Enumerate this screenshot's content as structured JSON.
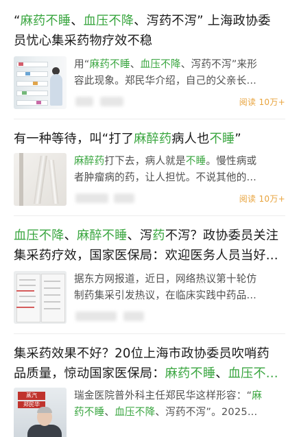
{
  "articles": [
    {
      "title_lines": [
        [
          {
            "text": "“",
            "hl": false
          },
          {
            "text": "麻药不睡",
            "hl": true
          },
          {
            "text": "、",
            "hl": false
          },
          {
            "text": "血压不降",
            "hl": true
          },
          {
            "text": "、泻药不泻” 上海政协委",
            "hl": false
          }
        ],
        [
          {
            "text": "员忧心集采药物疗效不稳",
            "hl": false
          }
        ]
      ],
      "snippet_lines": [
        [
          {
            "text": "用“",
            "hl": false
          },
          {
            "text": "麻药不睡",
            "hl": true
          },
          {
            "text": "、",
            "hl": false
          },
          {
            "text": "血压不降",
            "hl": true
          },
          {
            "text": "、泻药不泻”来形",
            "hl": false
          }
        ],
        [
          {
            "text": "容此现象。郑民华介绍，自己的父亲长...",
            "hl": false
          }
        ]
      ],
      "reads": "阅读 10万+",
      "thumb_icon": "pharmacy-shelf-thumbnail"
    },
    {
      "title_lines": [
        [
          {
            "text": "有一种等待，叫“打了",
            "hl": false
          },
          {
            "text": "麻醉药",
            "hl": true
          },
          {
            "text": "病人也",
            "hl": false
          },
          {
            "text": "不睡",
            "hl": true
          },
          {
            "text": "”",
            "hl": false
          }
        ]
      ],
      "snippet_lines": [
        [
          {
            "text": "麻醉药",
            "hl": true
          },
          {
            "text": "打下去，病人就是",
            "hl": false
          },
          {
            "text": "不睡",
            "hl": true
          },
          {
            "text": "。慢性病或",
            "hl": false
          }
        ],
        [
          {
            "text": "者肿瘤病的药，让人担忧。不说其他的...",
            "hl": false
          }
        ]
      ],
      "reads": "阅读 10万+",
      "thumb_icon": "curtain-thumbnail"
    },
    {
      "title_lines": [
        [
          {
            "text": "血压不降",
            "hl": true
          },
          {
            "text": "、",
            "hl": false
          },
          {
            "text": "麻醉不睡",
            "hl": true
          },
          {
            "text": "、泻",
            "hl": false
          },
          {
            "text": "药",
            "hl": true
          },
          {
            "text": "不泻？政协委员关注",
            "hl": false
          }
        ],
        [
          {
            "text": "集采药疗效，国家医保局：欢迎医务人员当好...",
            "hl": false
          }
        ]
      ],
      "snippet_lines": [
        [
          {
            "text": "据东方网报道，近日，网络热议第十轮仿",
            "hl": false
          }
        ],
        [
          {
            "text": "制药集采引发热议，在临床实践中药品...",
            "hl": false
          }
        ]
      ],
      "reads": "",
      "thumb_icon": "document-thumbnail"
    },
    {
      "title_lines": [
        [
          {
            "text": "集采药效果不好？20位上海市政协委员吹哨药",
            "hl": false
          }
        ],
        [
          {
            "text": "品质量，惊动国家医保局：",
            "hl": false
          },
          {
            "text": "麻药不睡",
            "hl": true
          },
          {
            "text": "、",
            "hl": false
          },
          {
            "text": "血压不...",
            "hl": true
          }
        ]
      ],
      "snippet_lines": [
        [
          {
            "text": "瑞金医院普外科主任郑民华这样形容：“",
            "hl": false
          },
          {
            "text": "麻",
            "hl": true
          }
        ],
        [
          {
            "text": "药不睡",
            "hl": true
          },
          {
            "text": "、",
            "hl": false
          },
          {
            "text": "血压不降",
            "hl": true
          },
          {
            "text": "、泻药不泻”。2025...",
            "hl": false
          }
        ]
      ],
      "reads": "",
      "thumb_icon": "doctor-portrait-thumbnail",
      "thumb_sign_top": "蒸汽",
      "thumb_sign_bottom": "郑民华"
    }
  ],
  "colors": {
    "highlight": "#3aa640",
    "reads": "#e8a33c",
    "title": "#1a1a1a",
    "snippet": "#505050"
  }
}
